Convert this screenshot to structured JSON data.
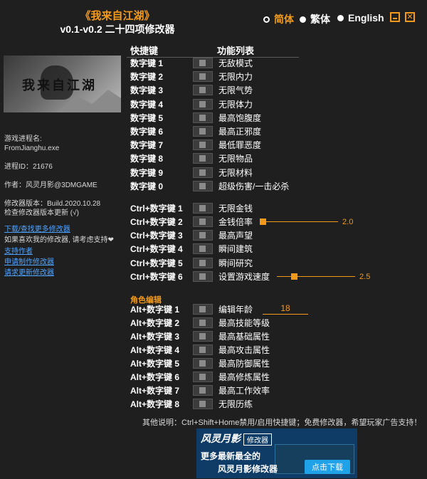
{
  "header": {
    "game_title": "《我来自江湖》",
    "subtitle": "v0.1-v0.2 二十四项修改器",
    "languages": [
      {
        "label": "简体",
        "selected": true
      },
      {
        "label": "繁体",
        "selected": false
      },
      {
        "label": "English",
        "selected": false
      }
    ],
    "accent_color": "#f39a1a"
  },
  "sidebar": {
    "banner_text": "我来自江湖",
    "process_label": "游戏进程名:",
    "process_name": "FromJianghu.exe",
    "pid": "进程ID：21676",
    "author": "作者：风灵月影@3DMGAME",
    "version": "修改器版本：Build.2020.10.28",
    "check_update": "检查修改器版本更新 (√)",
    "links": [
      "下载/查找更多修改器"
    ],
    "support_note": "如果喜欢我的修改器, 请考虑支持❤",
    "links2": [
      "支持作者",
      "申请制作修改器",
      "请求更新修改器"
    ]
  },
  "columns": {
    "hotkey": "快捷键",
    "features": "功能列表"
  },
  "rows_group1": [
    {
      "key": "数字键 1",
      "label": "无敌模式"
    },
    {
      "key": "数字键 2",
      "label": "无限内力"
    },
    {
      "key": "数字键 3",
      "label": "无限气势"
    },
    {
      "key": "数字键 4",
      "label": "无限体力"
    },
    {
      "key": "数字键 5",
      "label": "最高饱腹度"
    },
    {
      "key": "数字键 6",
      "label": "最高正邪度"
    },
    {
      "key": "数字键 7",
      "label": "最低罪恶度"
    },
    {
      "key": "数字键 8",
      "label": "无限物品"
    },
    {
      "key": "数字键 9",
      "label": "无限材料"
    },
    {
      "key": "数字键 0",
      "label": "超级伤害/一击必杀"
    }
  ],
  "rows_group2": [
    {
      "key": "Ctrl+数字键 1",
      "label": "无限金钱"
    },
    {
      "key": "Ctrl+数字键 2",
      "label": "金钱倍率",
      "slider_value": "2.0",
      "slider_fraction": 0.0
    },
    {
      "key": "Ctrl+数字键 3",
      "label": "最高声望"
    },
    {
      "key": "Ctrl+数字键 4",
      "label": "瞬间建筑"
    },
    {
      "key": "Ctrl+数字键 5",
      "label": "瞬间研究"
    },
    {
      "key": "Ctrl+数字键 6",
      "label": "设置游戏速度",
      "slider_value": "2.5",
      "slider_fraction": 0.2
    }
  ],
  "section_title": "角色编辑",
  "rows_group3": [
    {
      "key": "Alt+数字键 1",
      "label": "编辑年龄",
      "edit_value": "18"
    },
    {
      "key": "Alt+数字键 2",
      "label": "最高技能等级"
    },
    {
      "key": "Alt+数字键 3",
      "label": "最高基础属性"
    },
    {
      "key": "Alt+数字键 4",
      "label": "最高攻击属性"
    },
    {
      "key": "Alt+数字键 5",
      "label": "最高防御属性"
    },
    {
      "key": "Alt+数字键 6",
      "label": "最高修炼属性"
    },
    {
      "key": "Alt+数字键 7",
      "label": "最高工作效率"
    },
    {
      "key": "Alt+数字键 8",
      "label": "无限历练"
    }
  ],
  "footer": {
    "note": "其他说明：Ctrl+Shift+Home禁用/启用快捷键；免费修改器，希望玩家广告支持！"
  },
  "ad": {
    "brand": "风灵月影",
    "tag": "修改器",
    "line1": "更多最新最全的",
    "line2": "风灵月影修改器",
    "download": "点击下载"
  }
}
